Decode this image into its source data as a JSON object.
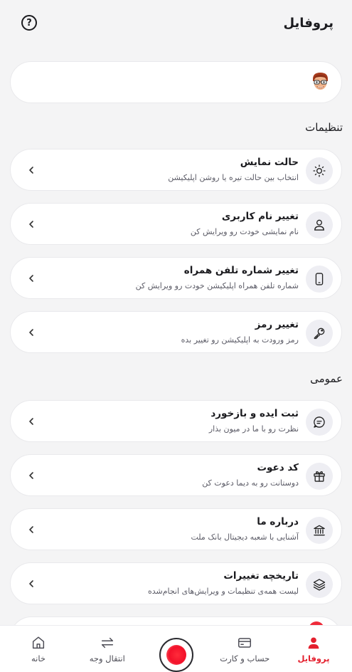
{
  "header": {
    "title": "پروفایل",
    "help_icon": "help-circle-icon"
  },
  "profile": {
    "avatar_icon": "memoji-avatar"
  },
  "sections": {
    "settings_title": "تنظیمات",
    "general_title": "عمومی"
  },
  "settings_items": [
    {
      "title": "حالت نمایش",
      "subtitle": "انتخاب بین حالت تیره یا روشن اپلیکیشن",
      "icon": "sun-icon"
    },
    {
      "title": "تغییر نام کاربری",
      "subtitle": "نام نمایشی خودت رو ویرایش کن",
      "icon": "user-icon"
    },
    {
      "title": "تغییر شماره تلفن همراه",
      "subtitle": "شماره تلفن همراه اپلیکیشن خودت رو ویرایش کن",
      "icon": "phone-icon"
    },
    {
      "title": "تغییر رمز",
      "subtitle": "رمز ورودت به اپلیکیشن رو تغییر بده",
      "icon": "key-icon"
    }
  ],
  "general_items": [
    {
      "title": "ثبت ایده و بازخورد",
      "subtitle": "نظرت رو با ما در میون بذار",
      "icon": "chat-bubble-icon"
    },
    {
      "title": "کد دعوت",
      "subtitle": "دوستانت رو به دیما دعوت کن",
      "icon": "gift-icon"
    },
    {
      "title": "درباره ما",
      "subtitle": "آشنایی با شعبه دیجیتال بانک ملت",
      "icon": "bank-icon"
    },
    {
      "title": "تاریخچه تغییرات",
      "subtitle": "لیست همه‌ی تنظیمات و ویرایش‌های انجام‌شده",
      "icon": "layers-icon"
    }
  ],
  "bottom_nav": {
    "home": "خانه",
    "transfer": "انتقال وجه",
    "accounts": "حساب و کارت",
    "profile": "پروفایل",
    "active_color": "#e4202e"
  }
}
